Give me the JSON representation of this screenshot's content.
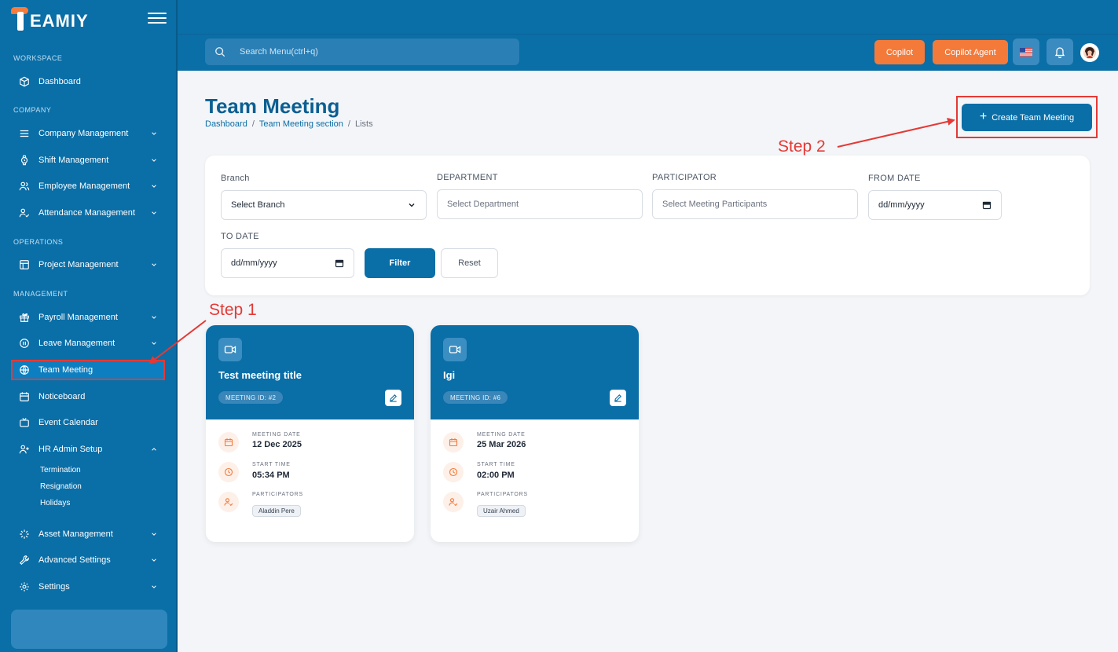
{
  "app": {
    "logo_text": "EAMIY"
  },
  "sidebar": {
    "sections": {
      "workspace": "WORKSPACE",
      "company": "COMPANY",
      "operations": "OPERATIONS",
      "management": "MANAGEMENT"
    },
    "items": {
      "dashboard": "Dashboard",
      "company_management": "Company Management",
      "shift_management": "Shift Management",
      "employee_management": "Employee Management",
      "attendance_management": "Attendance Management",
      "project_management": "Project Management",
      "payroll_management": "Payroll Management",
      "leave_management": "Leave Management",
      "team_meeting": "Team Meeting",
      "noticeboard": "Noticeboard",
      "event_calendar": "Event Calendar",
      "hr_admin_setup": "HR Admin Setup",
      "asset_management": "Asset Management",
      "advanced_settings": "Advanced Settings",
      "settings": "Settings"
    },
    "hr_subitems": [
      "Termination",
      "Resignation",
      "Holidays"
    ]
  },
  "topbar": {
    "search_placeholder": "Search Menu(ctrl+q)",
    "copilot_label": "Copilot",
    "copilot_agent_label": "Copilot Agent"
  },
  "page": {
    "title": "Team Meeting",
    "breadcrumb": [
      "Dashboard",
      "Team Meeting section",
      "Lists"
    ],
    "create_label": "Create Team Meeting"
  },
  "annotations": {
    "step1": "Step 1",
    "step2": "Step 2"
  },
  "filters": {
    "branch_label": "Branch",
    "branch_value": "Select Branch",
    "department_label": "DEPARTMENT",
    "department_placeholder": "Select Department",
    "participator_label": "PARTICIPATOR",
    "participator_placeholder": "Select Meeting Participants",
    "from_date_label": "FROM DATE",
    "from_date_value": "dd/mm/yyyy",
    "to_date_label": "TO DATE",
    "to_date_value": "dd/mm/yyyy",
    "filter_label": "Filter",
    "reset_label": "Reset"
  },
  "card_labels": {
    "meeting_date": "MEETING DATE",
    "start_time": "START TIME",
    "participators": "PARTICIPATORS"
  },
  "meetings": [
    {
      "title": "Test meeting title",
      "meeting_id": "MEETING ID: #2",
      "date": "12 Dec 2025",
      "start_time": "05:34 PM",
      "participant": "Aladdin Pere"
    },
    {
      "title": "Igi",
      "meeting_id": "MEETING ID: #6",
      "date": "25 Mar 2026",
      "start_time": "02:00 PM",
      "participant": "Uzair Ahmed"
    }
  ],
  "colors": {
    "primary": "#0a6ea7",
    "accent_orange": "#f47a3a",
    "annotation_red": "#e53935"
  }
}
